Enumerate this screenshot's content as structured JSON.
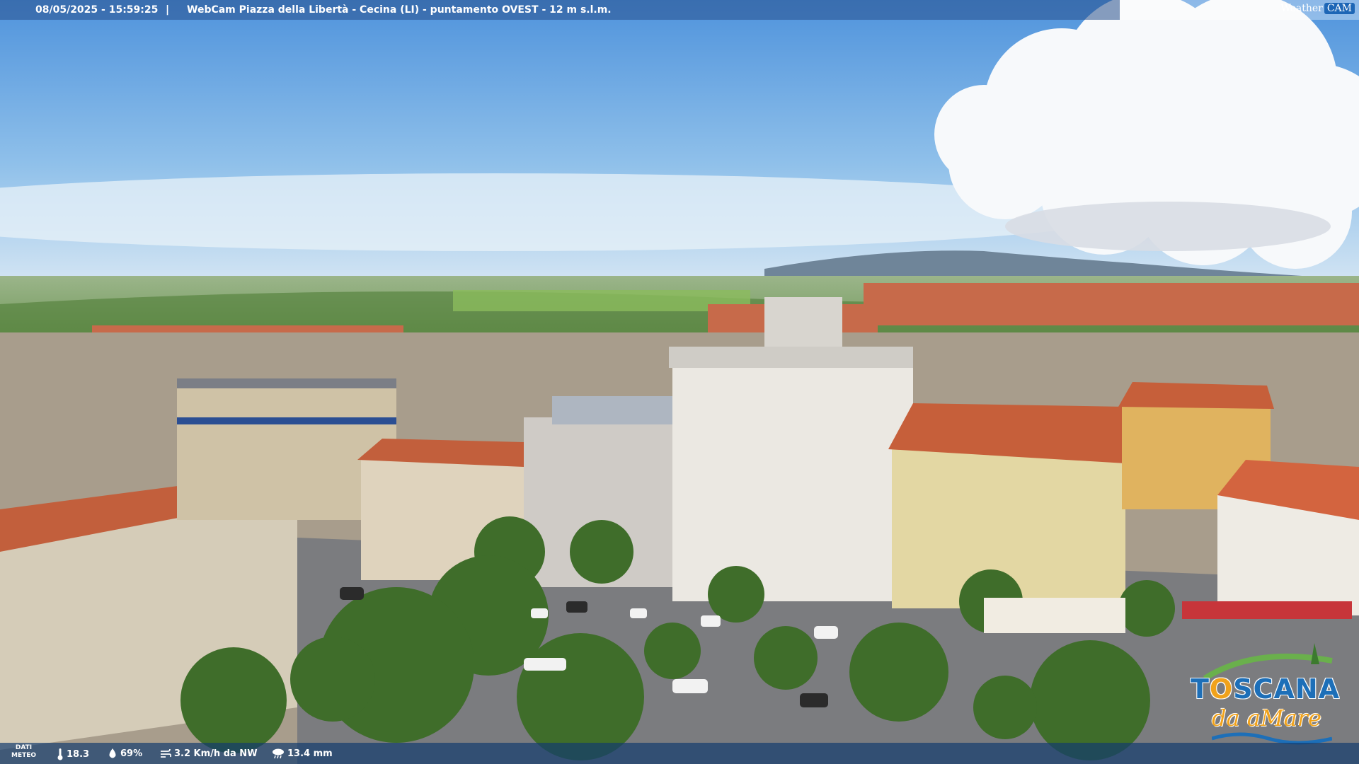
{
  "overlay": {
    "timestamp": "08/05/2025 - 15:59:25",
    "separator": "|",
    "caption": "WebCam Piazza della Libertà - Cecina (LI) - puntamento OVEST - 12 m s.l.m.",
    "brand_weather": "Weather",
    "brand_cam": "CAM"
  },
  "weather": {
    "label_line1": "DATI",
    "label_line2": "METEO",
    "temperature": "18.3",
    "humidity": "69%",
    "wind": "3.2 Km/h da NW",
    "rain": "13.4 mm",
    "icons": [
      "thermometer-icon",
      "humidity-drop-icon",
      "wind-icon",
      "rain-cloud-icon"
    ]
  },
  "watermark": {
    "line1_a": "T",
    "line1_o": "O",
    "line1_b": "SCANA",
    "line2": "da aMare"
  },
  "colors": {
    "sky_top": "#5b9be0",
    "sky_horizon": "#d6e7f5",
    "roof": "#c9603d",
    "accent_blue": "#1d6fb8",
    "accent_orange": "#f0a21b"
  }
}
